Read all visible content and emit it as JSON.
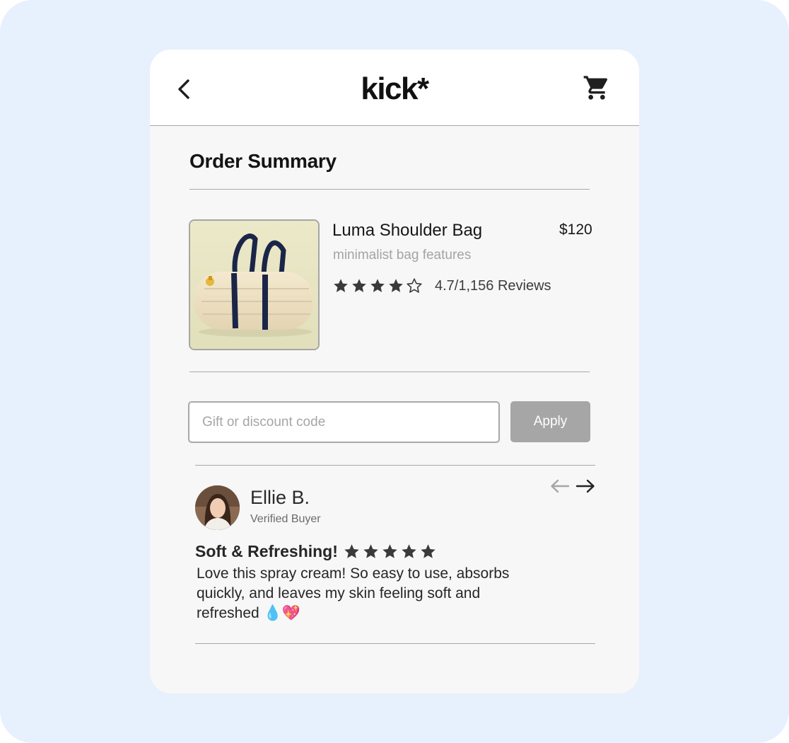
{
  "header": {
    "logo": "kick*",
    "back_icon": "chevron-left-icon",
    "cart_icon": "shopping-cart-icon"
  },
  "order_summary": {
    "title": "Order Summary"
  },
  "product": {
    "name": "Luma Shoulder Bag",
    "price": "$120",
    "description": "minimalist bag features",
    "rating_value": 4,
    "rating_max": 5,
    "rating_text": "4.7/1,156 Reviews",
    "image_icon": "duffel-bag-image"
  },
  "discount": {
    "placeholder": "Gift or discount code",
    "value": "",
    "apply_label": "Apply"
  },
  "review": {
    "reviewer_name": "Ellie B.",
    "reviewer_badge": "Verified Buyer",
    "title": "Soft & Refreshing!",
    "stars": 5,
    "body": "Love this spray cream! So easy to use, absorbs quickly, and leaves my skin feeling soft and refreshed 💧💖",
    "prev_icon": "arrow-left-icon",
    "next_icon": "arrow-right-icon"
  },
  "colors": {
    "backdrop": "#e7f0fd",
    "card": "#f6f7f6",
    "divider": "#a8a8a8",
    "apply_button": "#a6a6a6",
    "star": "#3a3a3a"
  }
}
